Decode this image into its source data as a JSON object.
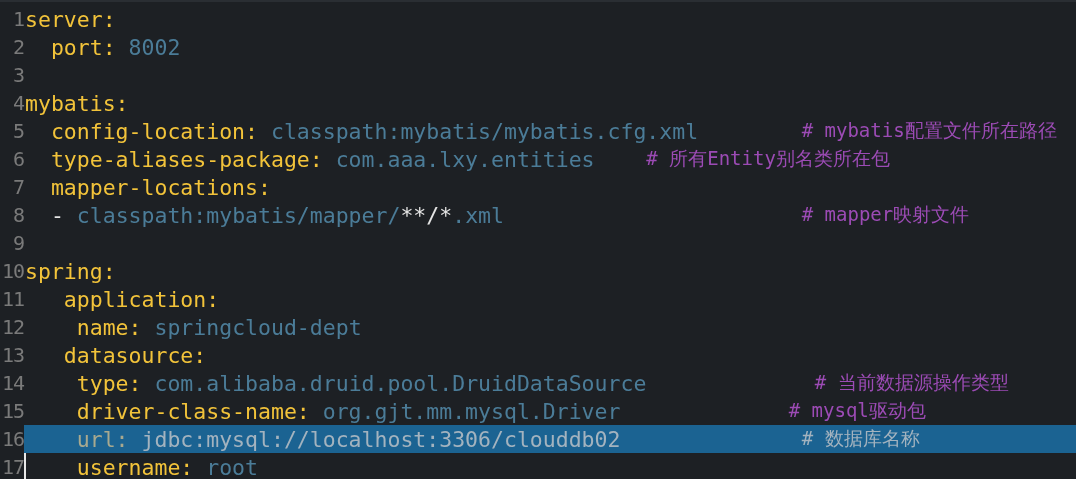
{
  "editor": {
    "lines": [
      {
        "number": "1",
        "selected": false,
        "cursor": false,
        "parts": [
          {
            "kind": "key",
            "text": "server:"
          }
        ]
      },
      {
        "number": "2",
        "selected": false,
        "cursor": false,
        "parts": [
          {
            "kind": "key",
            "text": "  port: "
          },
          {
            "kind": "value",
            "text": "8002"
          }
        ]
      },
      {
        "number": "3",
        "selected": false,
        "cursor": false
      },
      {
        "number": "4",
        "selected": false,
        "cursor": false,
        "parts": [
          {
            "kind": "key",
            "text": "mybatis:"
          }
        ]
      },
      {
        "number": "5",
        "selected": false,
        "cursor": false,
        "parts": [
          {
            "kind": "key",
            "text": "  config-location: "
          },
          {
            "kind": "value",
            "text": "classpath:mybatis/mybatis.cfg.xml"
          },
          {
            "kind": "comment",
            "text": "        # mybatis配置文件所在路径"
          }
        ]
      },
      {
        "number": "6",
        "selected": false,
        "cursor": false,
        "parts": [
          {
            "kind": "key",
            "text": "  type-aliases-package: "
          },
          {
            "kind": "value",
            "text": "com.aaa.lxy.entities"
          },
          {
            "kind": "comment",
            "text": "    # 所有Entity别名类所在包"
          }
        ]
      },
      {
        "number": "7",
        "selected": false,
        "cursor": false,
        "parts": [
          {
            "kind": "key",
            "text": "  mapper-locations:"
          }
        ]
      },
      {
        "number": "8",
        "selected": false,
        "cursor": false,
        "parts": [
          {
            "kind": "plain",
            "text": "  - "
          },
          {
            "kind": "value",
            "text": "classpath:mybatis/mapper/"
          },
          {
            "kind": "plain",
            "text": "**/*"
          },
          {
            "kind": "value",
            "text": ".xml"
          },
          {
            "kind": "comment",
            "text": "                       # mapper映射文件"
          }
        ]
      },
      {
        "number": "9",
        "selected": false,
        "cursor": false
      },
      {
        "number": "10",
        "selected": false,
        "cursor": false,
        "parts": [
          {
            "kind": "key",
            "text": "spring:"
          }
        ]
      },
      {
        "number": "11",
        "selected": false,
        "cursor": false,
        "parts": [
          {
            "kind": "key",
            "text": "   application:"
          }
        ]
      },
      {
        "number": "12",
        "selected": false,
        "cursor": false,
        "parts": [
          {
            "kind": "key",
            "text": "    name: "
          },
          {
            "kind": "value",
            "text": "springcloud-dept"
          }
        ]
      },
      {
        "number": "13",
        "selected": false,
        "cursor": false,
        "parts": [
          {
            "kind": "key",
            "text": "   datasource:"
          }
        ]
      },
      {
        "number": "14",
        "selected": false,
        "cursor": false,
        "parts": [
          {
            "kind": "key",
            "text": "    type: "
          },
          {
            "kind": "value",
            "text": "com.alibaba.druid.pool.DruidDataSource"
          },
          {
            "kind": "comment",
            "text": "             # 当前数据源操作类型"
          }
        ]
      },
      {
        "number": "15",
        "selected": false,
        "cursor": false,
        "parts": [
          {
            "kind": "key",
            "text": "    driver-class-name: "
          },
          {
            "kind": "value",
            "text": "org.gjt.mm.mysql.Driver"
          },
          {
            "kind": "comment",
            "text": "             # mysql驱动包"
          }
        ]
      },
      {
        "number": "16",
        "selected": true,
        "cursor": false,
        "parts": [
          {
            "kind": "key",
            "text": "    url: "
          },
          {
            "kind": "value",
            "text": "jdbc:mysql://localhost:3306/clouddb02"
          },
          {
            "kind": "comment",
            "text": "              # 数据库名称"
          }
        ]
      },
      {
        "number": "17",
        "selected": false,
        "cursor": true,
        "parts": [
          {
            "kind": "key",
            "text": "    username: "
          },
          {
            "kind": "value",
            "text": "root"
          }
        ]
      }
    ]
  }
}
